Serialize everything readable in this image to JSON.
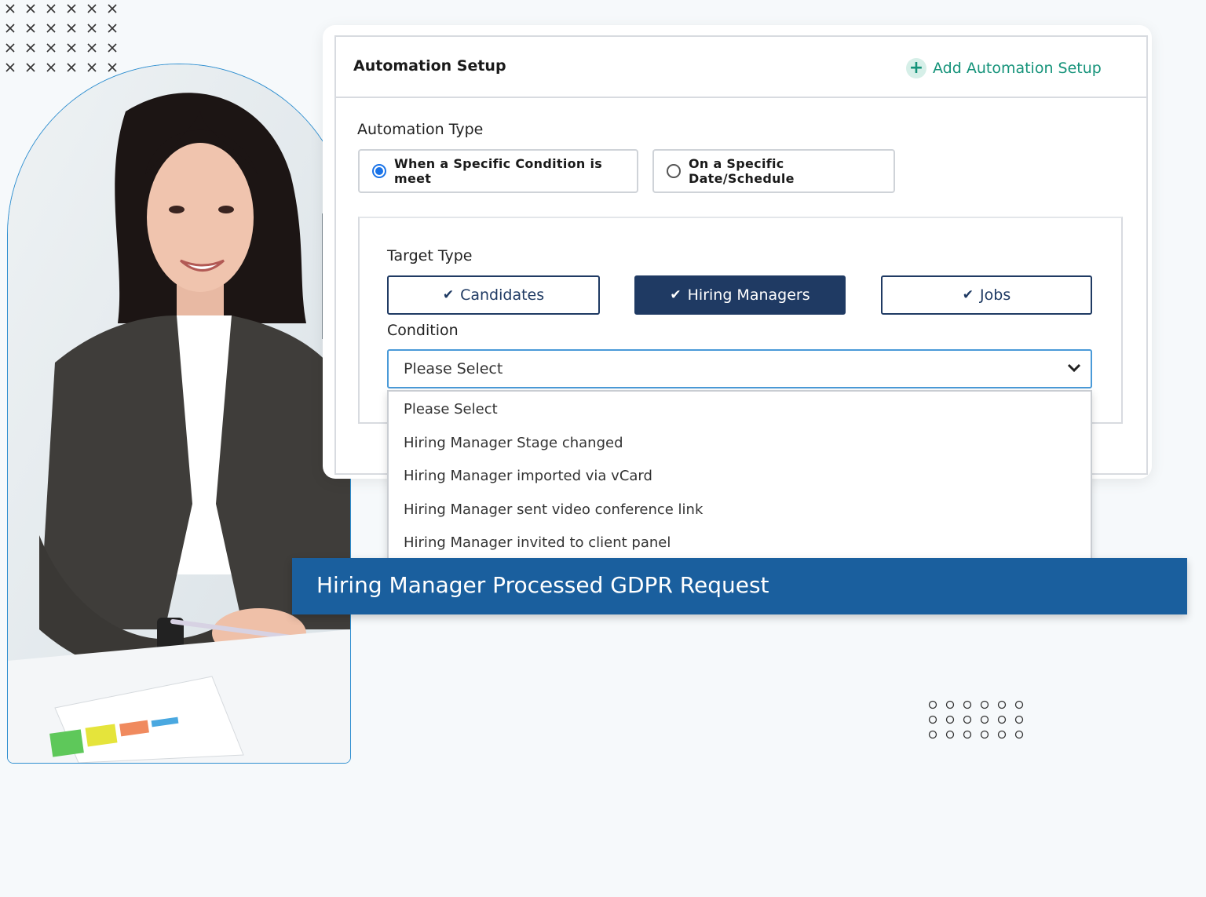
{
  "card": {
    "title": "Automation Setup",
    "add_label": "Add Automation Setup"
  },
  "automation_type": {
    "label": "Automation Type",
    "options": [
      {
        "label": "When a Specific Condition is meet",
        "selected": true
      },
      {
        "label": "On a Specific Date/Schedule",
        "selected": false
      }
    ]
  },
  "target_type": {
    "label": "Target Type",
    "options": [
      {
        "label": "Candidates",
        "active": false
      },
      {
        "label": "Hiring Managers",
        "active": true
      },
      {
        "label": "Jobs",
        "active": false
      }
    ]
  },
  "condition": {
    "label": "Condition",
    "value": "Please Select",
    "options": [
      "Please Select",
      "Hiring Manager Stage changed",
      "Hiring Manager imported via vCard",
      "Hiring Manager sent video conference link",
      "Hiring Manager invited to client panel",
      "Hiring Manager Processed GDPR Request"
    ],
    "highlighted_index": 5
  },
  "colors": {
    "navy": "#1f3a63",
    "accent_green": "#15937a",
    "highlight_blue": "#1a5f9e",
    "radio_blue": "#1a73e8"
  }
}
